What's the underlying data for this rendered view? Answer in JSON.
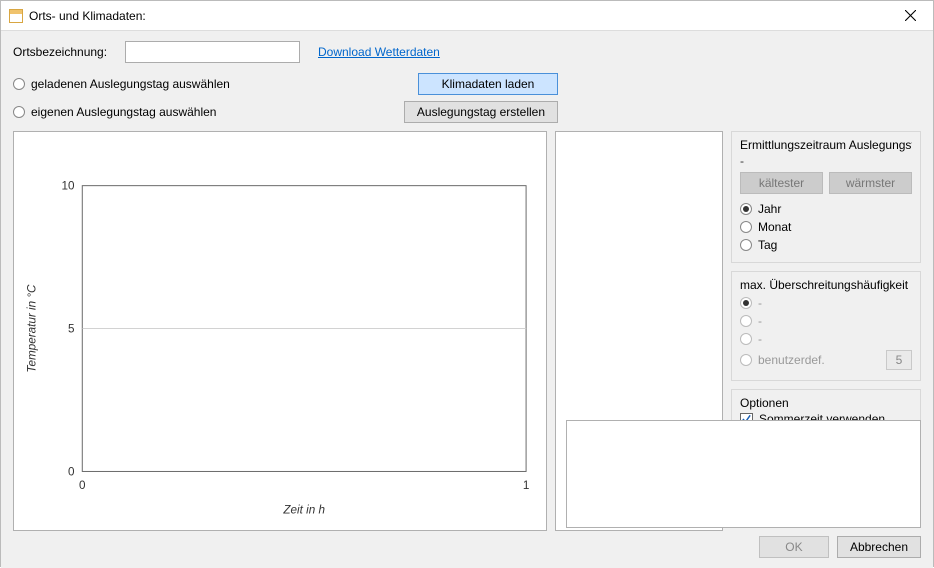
{
  "window": {
    "title": "Orts- und Klimadaten:"
  },
  "top": {
    "loc_label": "Ortsbezeichnung:",
    "loc_value": "",
    "download_link": "Download Wetterdaten"
  },
  "rows": {
    "radio_load": "geladenen Auslegungstag auswählen",
    "btn_load": "Klimadaten laden",
    "radio_own": "eigenen Auslegungstag auswählen",
    "btn_create": "Auslegungstag erstellen"
  },
  "chart_data": {
    "type": "line",
    "x": [],
    "y": [],
    "xlabel": "Zeit in h",
    "ylabel": "Temperatur in °C",
    "xlim": [
      0,
      1
    ],
    "ylim": [
      0,
      10
    ],
    "xticks": [
      0,
      1
    ],
    "yticks": [
      0,
      5,
      10
    ],
    "grid_y": [
      5
    ]
  },
  "period": {
    "title": "Ermittlungszeitraum Auslegungstag",
    "subtitle": "-",
    "btn_cold": "kältester",
    "btn_warm": "wärmster",
    "options": [
      "Jahr",
      "Monat",
      "Tag"
    ],
    "selected": 0
  },
  "exceed": {
    "title": "max. Überschreitungshäufigkeit",
    "options": [
      "-",
      "-",
      "-",
      "benutzerdef."
    ],
    "selected": 0,
    "custom_value": "5"
  },
  "options_panel": {
    "title": "Optionen",
    "dst_label": "Sommerzeit verwenden",
    "dst_checked": true
  },
  "footer": {
    "ok": "OK",
    "cancel": "Abbrechen"
  }
}
